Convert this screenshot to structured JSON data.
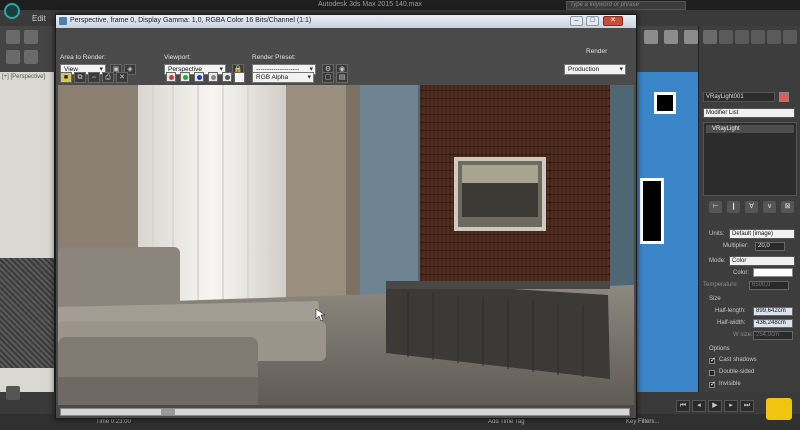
{
  "max": {
    "title": "Autodesk 3ds Max 2015      140.max",
    "search_placeholder": "Type a keyword or phrase",
    "menu_edit": "Edit",
    "viewport_label": "[+] [Perspective]",
    "status_left": "Time  0:23:00",
    "status_mid": "Add Time Tag",
    "status_right": "Key Filters..."
  },
  "frame_window": {
    "title": "Perspective, frame 0, Display Gamma: 1,0, RGBA Color 16 Bits/Channel (1:1)",
    "area_label": "Area to Render:",
    "area_value": "View",
    "viewport_label": "Viewport:",
    "viewport_value": "Perspective",
    "preset_label": "Render Preset:",
    "preset_value": "--------------------",
    "render_button": "Render",
    "production_value": "Production",
    "channel_value": "RGB Alpha",
    "close_glyph": "✕",
    "min_glyph": "–",
    "max_glyph": "□"
  },
  "command_panel": {
    "object_name": "VRayLight001",
    "modifier_list": "Modifier List",
    "stack_item": "VRayLight",
    "units_label": "Units:",
    "units_value": "Default (image)",
    "multiplier_label": "Multiplier:",
    "multiplier_value": "20,0",
    "mode_label": "Mode:",
    "mode_value": "Color",
    "color_label": "Color:",
    "temperature_label": "Temperature:",
    "temperature_value": "6500,0",
    "size_label": "Size",
    "half_length_label": "Half-length:",
    "half_length_value": "899,642cm",
    "half_width_label": "Half-width:",
    "half_width_value": "436,248cm",
    "w_size_label": "W size:",
    "w_size_value": "254,0cm",
    "options_label": "Options",
    "cast_shadows": "Cast shadows",
    "double_sided": "Double-sided",
    "invisible": "Invisible",
    "cast_shadows_on": true,
    "double_sided_on": false,
    "invisible_on": true
  },
  "colors": {
    "accent_blue": "#3a86c8",
    "title_bar": "#d6dde7",
    "close_red": "#c94c3a"
  },
  "icons": [
    "app-logo-icon",
    "save-icon",
    "clone-icon",
    "channel-red-icon",
    "channel-green-icon",
    "channel-blue-icon",
    "print-icon",
    "clear-icon",
    "close-icon"
  ]
}
